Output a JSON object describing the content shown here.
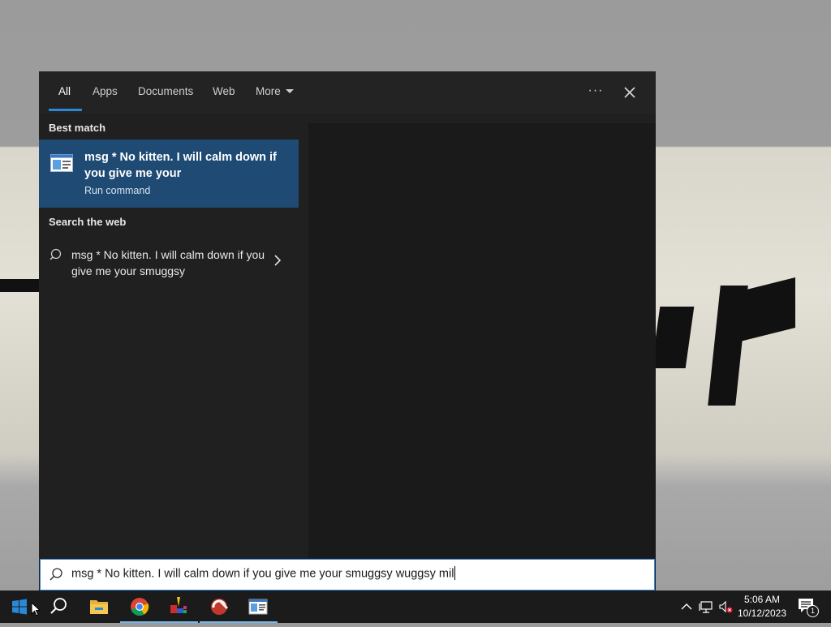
{
  "flyout": {
    "tabs": [
      {
        "label": "All",
        "active": true
      },
      {
        "label": "Apps"
      },
      {
        "label": "Documents"
      },
      {
        "label": "Web"
      },
      {
        "label": "More"
      }
    ],
    "ellipsis": "···",
    "best_match": {
      "heading": "Best match",
      "title": "msg * No kitten. I will calm down if you give me your",
      "subtitle": "Run command"
    },
    "web_search": {
      "heading": "Search the web",
      "text": "msg * No kitten. I will calm down if you give me your smuggsy"
    }
  },
  "search": {
    "value": "msg * No kitten. I will calm down if you give me your smuggsy wuggsy mil"
  },
  "taskbar": {
    "icons": [
      "windows-start-icon",
      "search-icon",
      "file-explorer-icon",
      "chrome-icon",
      "paint-app-icon",
      "ccleaner-icon",
      "document-viewer-icon"
    ],
    "clock": {
      "time": "5:06 AM",
      "date": "10/12/2023"
    },
    "notification_count": "1"
  },
  "colors": {
    "accent": "#2b88d8",
    "selection": "#1e4a73",
    "flyout_bg": "#202020",
    "taskbar_bg": "#1b1b1b"
  }
}
